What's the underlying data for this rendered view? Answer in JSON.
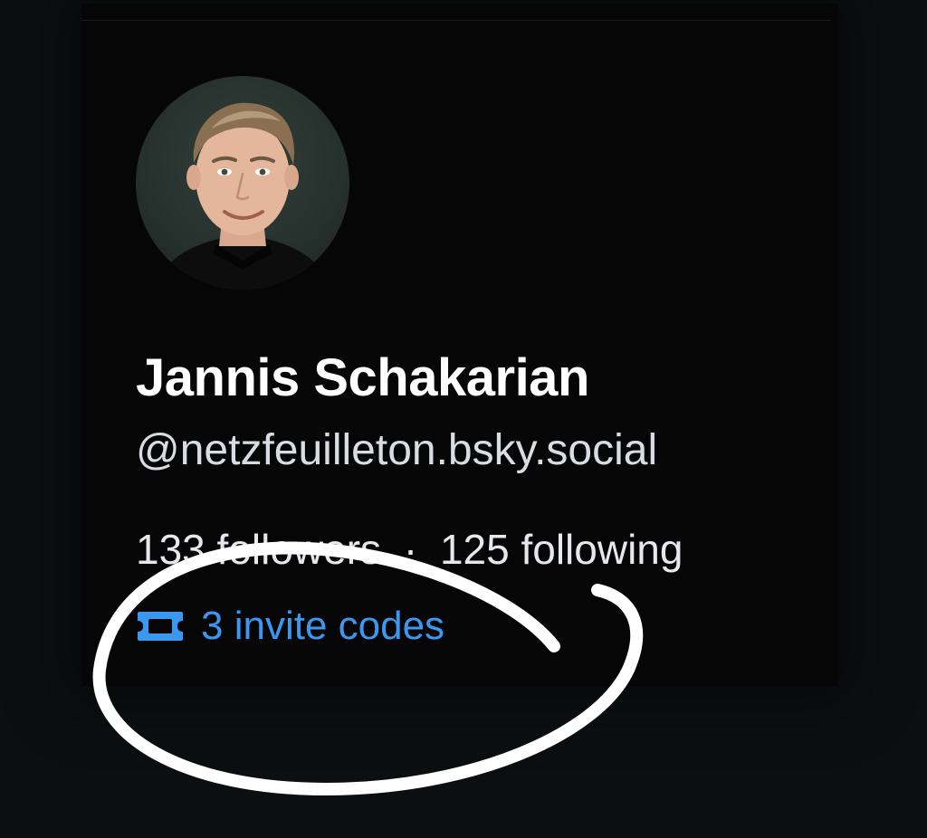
{
  "profile": {
    "display_name": "Jannis Schakarian",
    "handle": "@netzfeuilleton.bsky.social",
    "followers_count": "133",
    "followers_label": "followers",
    "separator": "·",
    "following_count": "125",
    "following_label": "following",
    "invite_codes": "3 invite codes"
  },
  "icons": {
    "avatar": "avatar-photo",
    "invite": "ticket-icon"
  },
  "colors": {
    "background": "#0b0f10",
    "card": "#060606",
    "link": "#3a98f0",
    "text_primary": "#ffffff",
    "text_secondary": "#d9dde2",
    "annotation": "#ffffff"
  }
}
